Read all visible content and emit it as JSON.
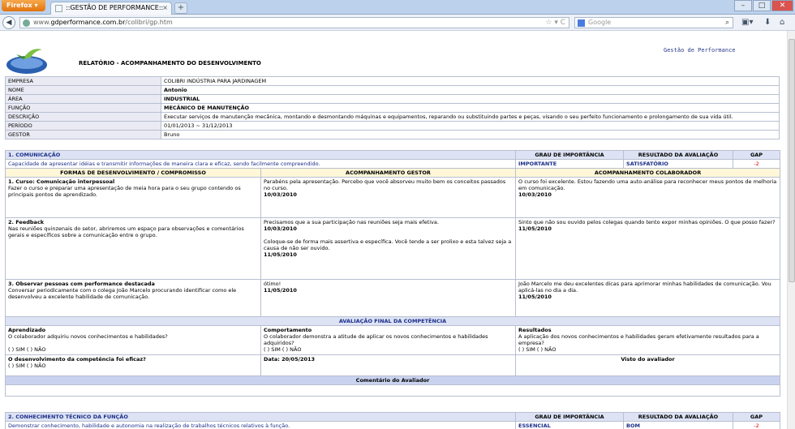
{
  "browser": {
    "app_button": "Firefox",
    "tab_title": "::GESTÃO DE PERFORMANCE::",
    "url_prefix": "www.",
    "url_domain": "gdperformance.com.br",
    "url_path": "/colibri/gp.htm",
    "search_placeholder": "Google"
  },
  "report": {
    "title": "RELATÓRIO - ACOMPANHAMENTO DO DESENVOLVIMENTO",
    "brand": "Gestão de Performance"
  },
  "info": [
    {
      "label": "EMPRESA",
      "value": "COLIBRI INDÚSTRIA PARA JARDINAGEM"
    },
    {
      "label": "NOME",
      "value": "Antonio"
    },
    {
      "label": "ÁREA",
      "value": "INDUSTRIAL"
    },
    {
      "label": "FUNÇÃO",
      "value": "MECÂNICO DE MANUTENÇÃO"
    },
    {
      "label": "DESCRIÇÃO",
      "value": "Executar serviços de manutenção mecânica, montando e desmontando máquinas e equipamentos, reparando ou substituindo partes e peças, visando o seu perfeito funcionamento e prolongamento de sua vida útil."
    },
    {
      "label": "PERÍODO",
      "value": "01/01/2013 ~ 31/12/2013"
    },
    {
      "label": "GESTOR",
      "value": "Bruno"
    }
  ],
  "headers": {
    "importance": "GRAU DE IMPORTÂNCIA",
    "result": "RESULTADO DA AVALIAÇÃO",
    "gap": "GAP",
    "forms": "FORMAS DE DESENVOLVIMENTO / COMPROMISSO",
    "manager": "ACOMPANHAMENTO GESTOR",
    "collab": "ACOMPANHAMENTO COLABORADOR"
  },
  "comp1": {
    "title": "1. COMUNICAÇÃO",
    "desc": "Capacidade de apresentar idéias e transmitir informações de maneira clara e eficaz, sendo facilmente compreendido.",
    "importance": "IMPORTANTE",
    "result": "SATISFATÓRIO",
    "gap": "-2",
    "rows": [
      {
        "title": "1. Curso: Comunicação interpessoal",
        "text": "Fazer o curso e preparar uma apresentação de meia hora para o seu grupo contendo os principais pontos de aprendizado.",
        "mgr1": "Parabéns pela apresentação. Percebo que você absorveu muito bem os conceitos passados no curso.",
        "mgr1_date": "10/03/2010",
        "mgr2": "",
        "mgr2_date": "",
        "col": "O curso foi excelente. Estou fazendo uma auto-análise para reconhecer meus pontos de melhoria em comunicação.",
        "col_date": "10/03/2010"
      },
      {
        "title": "2. Feedback",
        "text": "Nas reuniões quinzenais do setor, abriremos um espaço para observações e comentários gerais e específicos sobre a comunicação entre o grupo.",
        "mgr1": "Precisamos que a sua participação nas reuniões seja mais efetiva.",
        "mgr1_date": "10/03/2010",
        "mgr2": "Coloque-se de forma mais assertiva e específica. Você tende a ser prolixo e esta talvez seja a causa de não ser ouvido.",
        "mgr2_date": "11/05/2010",
        "col": "Sinto que não sou ouvido pelos colegas quando tento expor minhas opiniões. O que posso fazer?",
        "col_date": "11/05/2010"
      },
      {
        "title": "3. Observar pessoas com performance destacada",
        "text": "Conversar periodicamente com o colega João Marcelo procurando identificar como ele desenvolveu a excelente habilidade de comunicação.",
        "mgr1": "ótimo!",
        "mgr1_date": "11/05/2010",
        "mgr2": "",
        "mgr2_date": "",
        "col": "João Marcelo me deu excelentes dicas para aprimorar minhas habilidades de comunicação. Vou aplicá-las no dia a dia.",
        "col_date": "11/05/2010"
      }
    ]
  },
  "final": {
    "title": "AVALIAÇÃO FINAL DA COMPETÊNCIA",
    "learned_t": "Aprendizado",
    "learned_q": "O colaborador adquiriu novos conhecimentos e habilidades?",
    "learned_o": "( ) SIM ( ) NÃO",
    "behav_t": "Comportamento",
    "behav_q": "O colaborador demonstra a atitude de aplicar os novos conhecimentos e habilidades adquiridos?",
    "behav_o": "( ) SIM ( ) NÃO",
    "res_t": "Resultados",
    "res_q": "A aplicação dos novos conhecimentos e habilidades geram efetivamente resultados para a empresa?",
    "res_o": "( ) SIM ( ) NÃO",
    "eff_q": "O desenvolvimento da competência foi eficaz?",
    "eff_o": "( ) SIM ( ) NÃO",
    "date": "Data: 20/05/2013",
    "visto": "Visto do avaliador",
    "comment": "Comentário do Avaliador"
  },
  "comp2": {
    "title": "2. CONHECIMENTO TÉCNICO DA FUNÇÃO",
    "desc": "Demonstrar conhecimento, habilidade e autonomia na realização de trabalhos técnicos relativos à função.",
    "importance": "ESSENCIAL",
    "result": "BOM",
    "gap": "-2"
  }
}
